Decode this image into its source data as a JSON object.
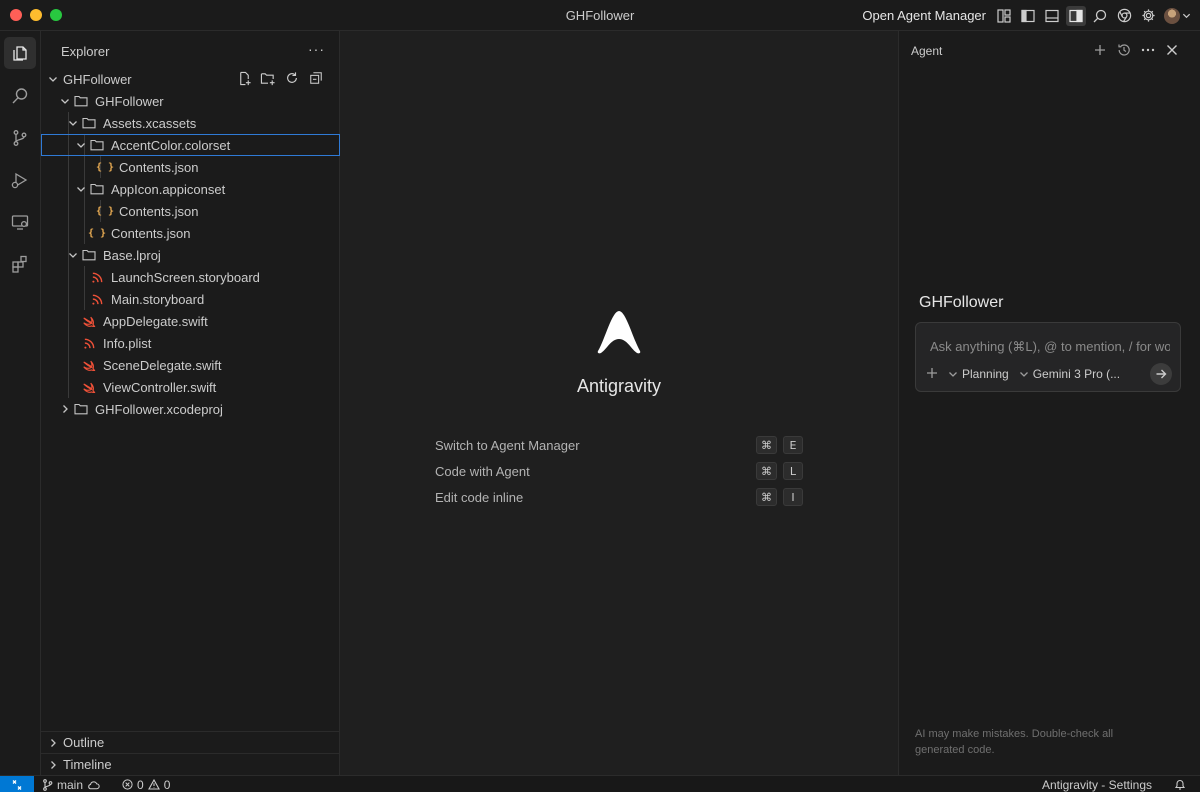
{
  "window": {
    "title": "GHFollower"
  },
  "titlebar": {
    "open_agent_manager": "Open Agent Manager"
  },
  "sidebar": {
    "title": "Explorer",
    "more": "···",
    "root": "GHFollower",
    "tree": [
      {
        "label": "GHFollower",
        "type": "folder",
        "expanded": true
      },
      {
        "label": "Assets.xcassets",
        "type": "folder",
        "expanded": true
      },
      {
        "label": "AccentColor.colorset",
        "type": "folder",
        "expanded": true,
        "selected": true
      },
      {
        "label": "Contents.json",
        "type": "json"
      },
      {
        "label": "AppIcon.appiconset",
        "type": "folder",
        "expanded": true
      },
      {
        "label": "Contents.json",
        "type": "json"
      },
      {
        "label": "Contents.json",
        "type": "json"
      },
      {
        "label": "Base.lproj",
        "type": "folder",
        "expanded": true
      },
      {
        "label": "LaunchScreen.storyboard",
        "type": "storyboard"
      },
      {
        "label": "Main.storyboard",
        "type": "storyboard"
      },
      {
        "label": "AppDelegate.swift",
        "type": "swift"
      },
      {
        "label": "Info.plist",
        "type": "plist"
      },
      {
        "label": "SceneDelegate.swift",
        "type": "swift"
      },
      {
        "label": "ViewController.swift",
        "type": "swift"
      },
      {
        "label": "GHFollower.xcodeproj",
        "type": "folder",
        "expanded": false
      }
    ],
    "sections": {
      "outline": "Outline",
      "timeline": "Timeline"
    }
  },
  "editor": {
    "brand": "Antigravity",
    "shortcuts": [
      {
        "label": "Switch to Agent Manager",
        "keys": [
          "⌘",
          "E"
        ]
      },
      {
        "label": "Code with Agent",
        "keys": [
          "⌘",
          "L"
        ]
      },
      {
        "label": "Edit code inline",
        "keys": [
          "⌘",
          "I"
        ]
      }
    ]
  },
  "agent": {
    "title": "Agent",
    "project": "GHFollower",
    "input_placeholder": "Ask anything (⌘L), @ to mention, / for workflows",
    "mode": "Planning",
    "model": "Gemini 3 Pro (...",
    "disclaimer": "AI may make mistakes. Double-check all generated code."
  },
  "statusbar": {
    "branch": "main",
    "errors": "0",
    "warnings": "0",
    "right": "Antigravity - Settings"
  },
  "colors": {
    "accent": "#0078d4",
    "selection_outline": "#2f7ad6",
    "json_icon": "#e8ab53",
    "swift_icon": "#f05138",
    "storyboard_icon": "#f05138"
  }
}
